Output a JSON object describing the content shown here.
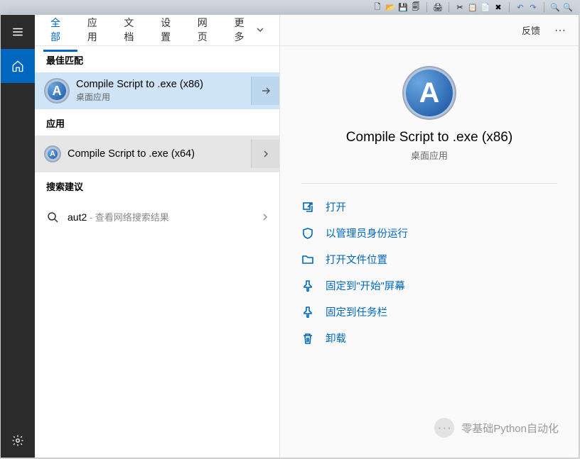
{
  "tabs": {
    "items": [
      "全部",
      "应用",
      "文档",
      "设置",
      "网页"
    ],
    "more": "更多",
    "feedback": "反馈"
  },
  "sections": {
    "best": "最佳匹配",
    "apps": "应用",
    "suggest": "搜索建议"
  },
  "bestMatch": {
    "title": "Compile Script to .exe (x86)",
    "subtitle": "桌面应用"
  },
  "appResult": {
    "title": "Compile Script to .exe (x64)"
  },
  "suggestion": {
    "query": "aut2",
    "hint": " - 查看网络搜索结果"
  },
  "detail": {
    "title": "Compile Script to .exe (x86)",
    "subtitle": "桌面应用",
    "actions": {
      "open": "打开",
      "runAdmin": "以管理员身份运行",
      "openLocation": "打开文件位置",
      "pinStart": "固定到\"开始\"屏幕",
      "pinTaskbar": "固定到任务栏",
      "uninstall": "卸载"
    }
  },
  "watermark": "零基础Python自动化",
  "iconGlyphs": {
    "logoLetter": "A"
  }
}
